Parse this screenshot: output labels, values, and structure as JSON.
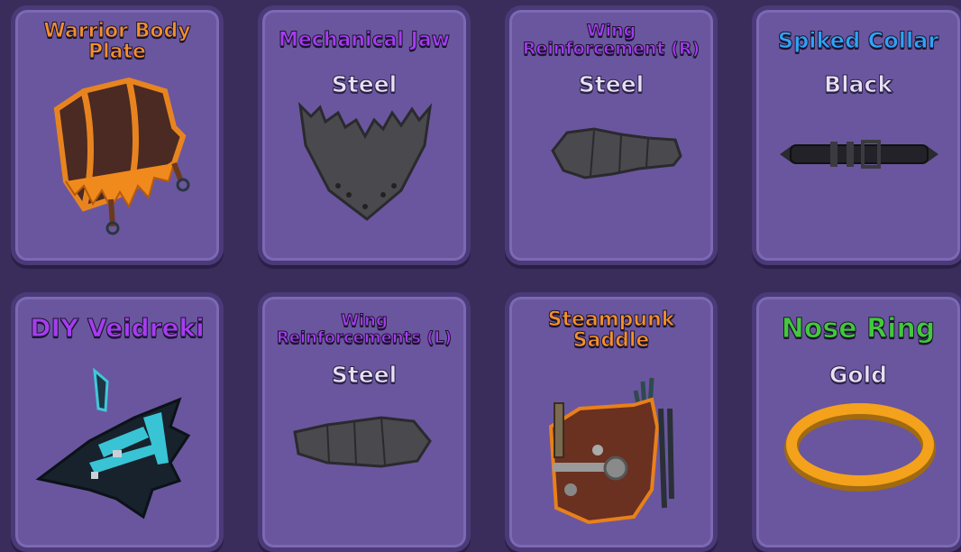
{
  "colors": {
    "background": "#3a2d5c",
    "card": "#6a569e",
    "rarity_orange": "#f5902b",
    "rarity_purple": "#a63cf0",
    "rarity_blue": "#2fa4f5",
    "rarity_green": "#41c93a"
  },
  "items": [
    {
      "name": "Warrior Body Plate",
      "variant": "",
      "rarity": "orange",
      "icon": "body-plate-icon"
    },
    {
      "name": "Mechanical Jaw",
      "variant": "Steel",
      "rarity": "purple",
      "icon": "jaw-icon"
    },
    {
      "name": "Wing Reinforcement (R)",
      "variant": "Steel",
      "rarity": "purple",
      "icon": "wing-reinforcement-icon"
    },
    {
      "name": "Spiked Collar",
      "variant": "Black",
      "rarity": "blue",
      "icon": "collar-icon"
    },
    {
      "name": "DIY Veidreki",
      "variant": "",
      "rarity": "purple",
      "icon": "veidreki-mask-icon"
    },
    {
      "name": "Wing Reinforcements (L)",
      "variant": "Steel",
      "rarity": "purple",
      "icon": "wing-reinforcement-icon"
    },
    {
      "name": "Steampunk Saddle",
      "variant": "",
      "rarity": "orange",
      "icon": "saddle-icon"
    },
    {
      "name": "Nose Ring",
      "variant": "Gold",
      "rarity": "green",
      "icon": "nose-ring-icon"
    }
  ]
}
